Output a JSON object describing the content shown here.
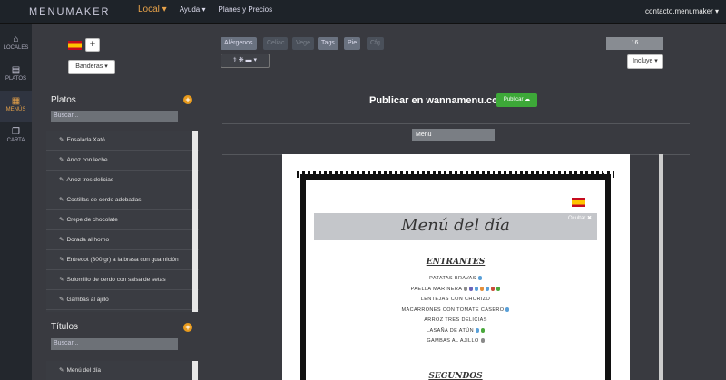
{
  "header": {
    "logo": "MENUMAKER",
    "nav": [
      {
        "label": "Local ▾"
      },
      {
        "label": "Ayuda ▾"
      },
      {
        "label": "Planes y Precios"
      }
    ],
    "account": "contacto.menumaker ▾"
  },
  "sidebar": {
    "items": [
      {
        "label": "LOCALES",
        "icon": "home-icon",
        "glyph": "⌂"
      },
      {
        "label": "PLATOS",
        "icon": "list-icon",
        "glyph": "▤"
      },
      {
        "label": "MENÚS",
        "icon": "document-icon",
        "glyph": "▦"
      },
      {
        "label": "CARTA",
        "icon": "copy-icon",
        "glyph": "❐"
      }
    ]
  },
  "toolbar": {
    "banderas_label": "Banderas ▾",
    "add_flag": "+",
    "pills": [
      {
        "label": "Alérgenos",
        "active": true
      },
      {
        "label": "Celiac",
        "active": false
      },
      {
        "label": "Vege",
        "active": false
      },
      {
        "label": "Tags",
        "active": true
      },
      {
        "label": "Pie",
        "active": true
      },
      {
        "label": "Cfg",
        "active": false
      }
    ],
    "icon_select": "⚕ ❋ ▬ ▾",
    "size_value": "16",
    "incluye_label": "Incluye ▾"
  },
  "platos": {
    "title": "Platos",
    "search_placeholder": "Buscar...",
    "items": [
      "Ensalada Xató",
      "Arroz con leche",
      "Arroz tres delicias",
      "Costillas de cerdo adobadas",
      "Crepe de chocolate",
      "Dorada al horno",
      "Entrecot (300 gr) a la brasa con guarnición",
      "Solomillo de cerdo con salsa de setas",
      "Gambas al ajillo"
    ]
  },
  "titulos": {
    "title": "Títulos",
    "search_placeholder": "Buscar...",
    "items": [
      "Menú del día"
    ]
  },
  "publish": {
    "text": "Publicar en wannamenu.com",
    "button": "Publicar ☁"
  },
  "menu_name": "Menu",
  "preview": {
    "title": "Menú del día",
    "ocultar": "Ocultar ✖",
    "sections": [
      {
        "name": "ENTRANTES",
        "dishes": [
          {
            "name": "PATATAS BRAVAS",
            "allergens": [
              "#5aa0d8"
            ]
          },
          {
            "name": "PAELLA MARINERA",
            "allergens": [
              "#8a8a8a",
              "#6b64b8",
              "#5aa0d8",
              "#e48f3a",
              "#5aa0d8",
              "#c94d3a",
              "#4aa83c"
            ]
          },
          {
            "name": "LENTEJAS CON CHORIZO",
            "allergens": []
          },
          {
            "name": "MACARRONES CON TOMATE CASERO",
            "allergens": [
              "#5aa0d8"
            ]
          },
          {
            "name": "ARROZ TRES DELICIAS",
            "allergens": []
          },
          {
            "name": "LASAÑA DE ATÚN",
            "allergens": [
              "#5aa0d8",
              "#4aa83c"
            ]
          },
          {
            "name": "GAMBAS AL AJILLO",
            "allergens": [
              "#8a8a8a"
            ]
          }
        ]
      },
      {
        "name": "SEGUNDOS",
        "dishes": []
      }
    ]
  }
}
